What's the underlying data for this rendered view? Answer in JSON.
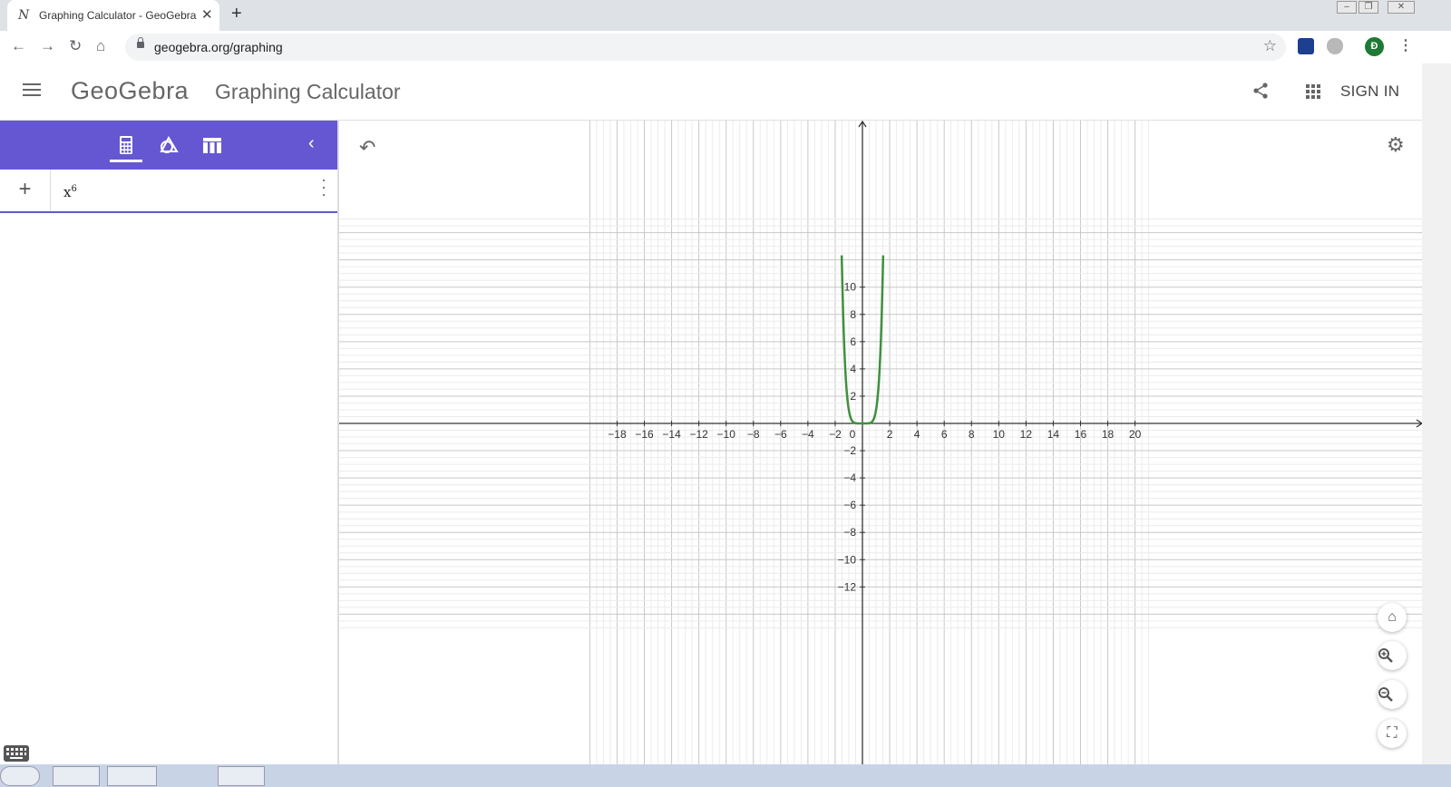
{
  "browser": {
    "tab_title": "Graphing Calculator - GeoGebra",
    "tab_favicon": "N",
    "url": "geogebra.org/graphing",
    "profile_initial": "Đ"
  },
  "app": {
    "logo": "GeoGebra",
    "title": "Graphing Calculator",
    "sign_in": "SIGN IN"
  },
  "algebra": {
    "input_base": "x",
    "input_exponent": "6"
  },
  "graph": {
    "x_ticks": [
      "−18",
      "−16",
      "−14",
      "−12",
      "−10",
      "−8",
      "−6",
      "−4",
      "−2",
      "0",
      "2",
      "4",
      "6",
      "8",
      "10",
      "12",
      "14",
      "16",
      "18",
      "20"
    ],
    "y_ticks_pos": [
      "10",
      "8",
      "6",
      "4",
      "2"
    ],
    "y_ticks_neg": [
      "−2",
      "−4",
      "−6",
      "−8",
      "−10",
      "−12"
    ],
    "function_color": "#3f8f3f"
  },
  "chart_data": {
    "type": "line",
    "title": "",
    "xlabel": "",
    "ylabel": "",
    "xlim": [
      -19.2,
      20.4
    ],
    "ylim": [
      -12.5,
      11.1
    ],
    "grid": true,
    "series": [
      {
        "name": "",
        "function": "x^6",
        "color": "#3f8f3f"
      }
    ]
  }
}
